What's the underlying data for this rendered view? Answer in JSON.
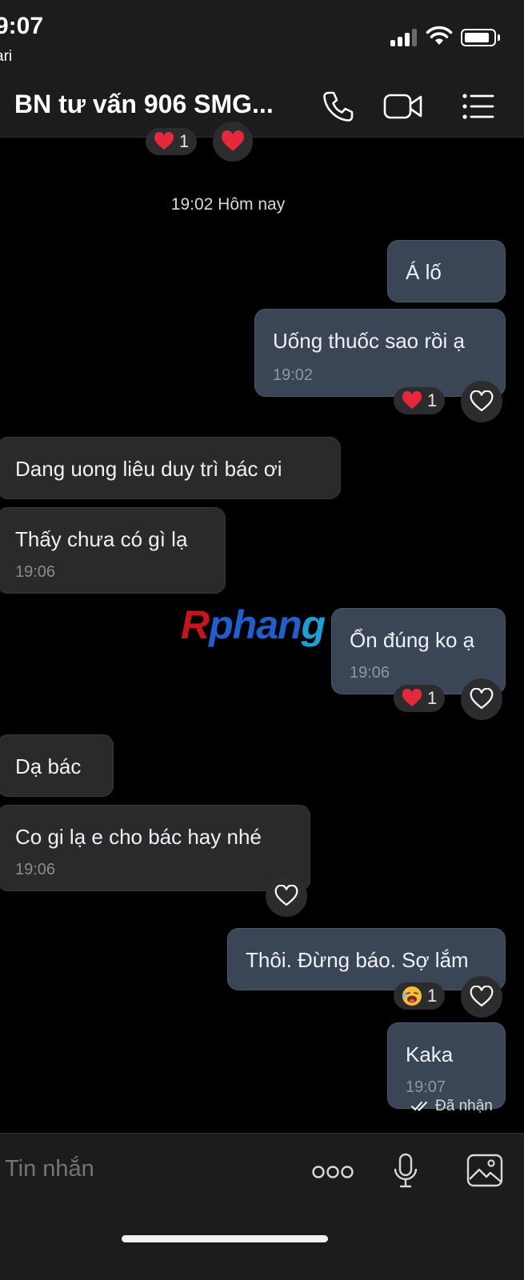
{
  "status_bar": {
    "time": "9:07",
    "back_app": "ari"
  },
  "header": {
    "title": "BN tư vấn 906 SMG...",
    "call_icon": "phone-icon",
    "video_icon": "video-camera-icon",
    "menu_icon": "list-menu-icon"
  },
  "top_reactions": {
    "count": "1"
  },
  "date_separator": "19:02 Hôm nay",
  "messages": [
    {
      "direction": "out",
      "text": "Á lố"
    },
    {
      "direction": "out",
      "text": "Uống thuốc sao rồi ạ",
      "time": "19:02",
      "reaction_count": "1"
    },
    {
      "direction": "in",
      "text": "Dang uong  liêu duy trì bác ơi"
    },
    {
      "direction": "in",
      "text": "Thấy chưa có gì lạ",
      "time": "19:06"
    },
    {
      "direction": "out",
      "text": "Ổn đúng ko ạ",
      "time": "19:06",
      "reaction_count": "1"
    },
    {
      "direction": "in",
      "text": "Dạ bác"
    },
    {
      "direction": "in",
      "text": "Co gi lạ e cho bác hay nhé",
      "time": "19:06"
    },
    {
      "direction": "out",
      "text": "Thôi. Đừng báo. Sợ lắm",
      "reaction_count": "1"
    },
    {
      "direction": "out",
      "text": "Kaka",
      "time": "19:07"
    }
  ],
  "delivery_status": "Đã nhận",
  "watermark": {
    "part1": "R",
    "part2": "phan",
    "part3": "g"
  },
  "composer": {
    "placeholder": "Tin nhắn"
  },
  "colors": {
    "outgoing_bubble": "#3a4656",
    "incoming_bubble": "#2a2a2c",
    "background": "#000000",
    "heart": "#e5283c"
  }
}
